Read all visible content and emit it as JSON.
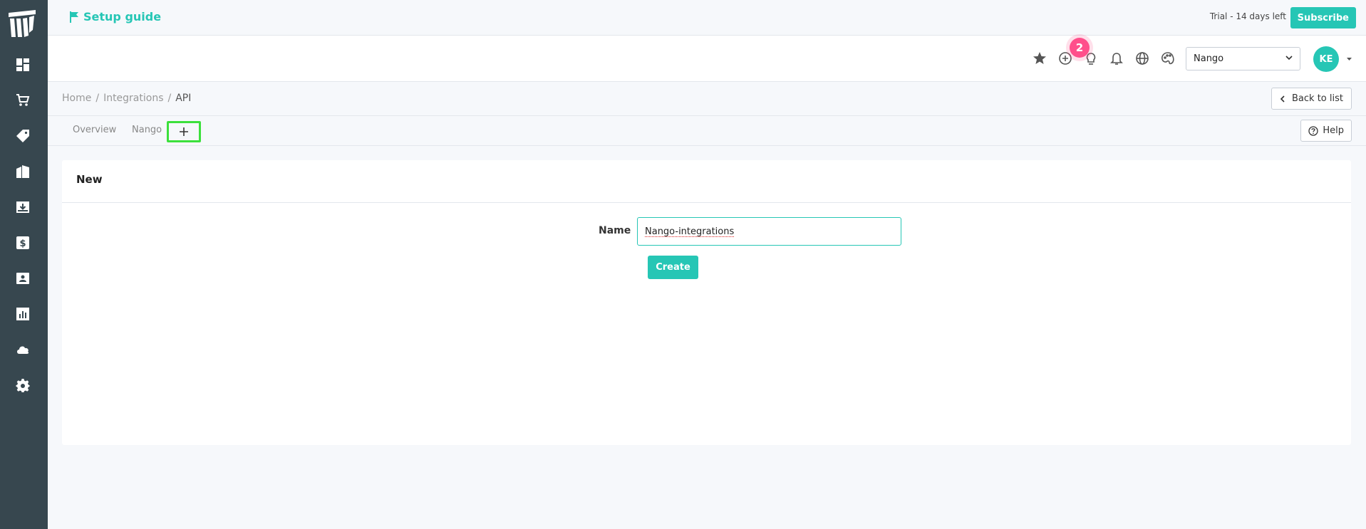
{
  "topbar": {
    "setup_guide": "Setup guide",
    "trial": "Trial - 14 days left",
    "subscribe": "Subscribe"
  },
  "header": {
    "notification_count": "2",
    "org_selected": "Nango",
    "avatar_initials": "KE"
  },
  "breadcrumb": {
    "home": "Home",
    "integrations": "Integrations",
    "current": "API",
    "separator": "/"
  },
  "back_button": "Back to list",
  "tabs": [
    {
      "label": "Overview"
    },
    {
      "label": "Nango"
    }
  ],
  "help_button": "Help",
  "form": {
    "title": "New",
    "name_label": "Name",
    "name_value": "Nango-integrations",
    "create_label": "Create"
  },
  "colors": {
    "accent": "#26c6b5",
    "sidebar": "#37474f",
    "badge": "#ff4f8b",
    "highlight": "#3ce03c"
  },
  "sidebar_icons": [
    "dashboard-icon",
    "cart-icon",
    "tag-icon",
    "building-icon",
    "inbox-download-icon",
    "dollar-icon",
    "contact-card-icon",
    "chart-icon",
    "cloud-icon",
    "gear-icon"
  ]
}
